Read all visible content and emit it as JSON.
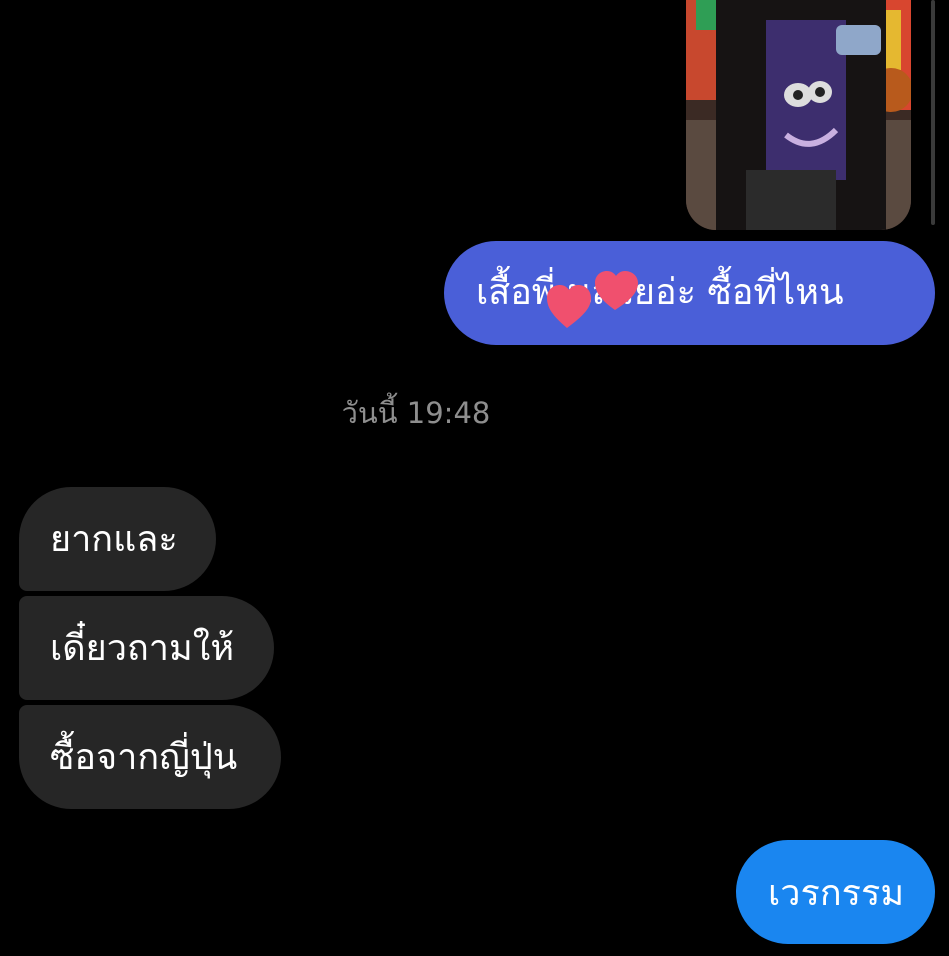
{
  "messages": [
    {
      "id": "m1",
      "direction": "outgoing",
      "text": "เสื้อพี่ นสวยอ่ะ ซื้อที่ไหน"
    },
    {
      "id": "m2",
      "direction": "incoming",
      "text": "ยากและ"
    },
    {
      "id": "m3",
      "direction": "incoming",
      "text": "เดี๋ยวถามให้"
    },
    {
      "id": "m4",
      "direction": "incoming",
      "text": "ซื้อจากญี่ปุ่น"
    },
    {
      "id": "m5",
      "direction": "outgoing",
      "text": "เวรกรรม"
    }
  ],
  "timestamp": "วันนี้ 19:48",
  "colors": {
    "background": "#000000",
    "outgoing_bubble": "#4a5fd8",
    "outgoing_bubble_latest": "#1a86f0",
    "incoming_bubble": "#262626",
    "timestamp_text": "#8e8e8e",
    "heart_sticker": "#f0506e"
  },
  "icons": {
    "sticker": "heart-icon"
  }
}
